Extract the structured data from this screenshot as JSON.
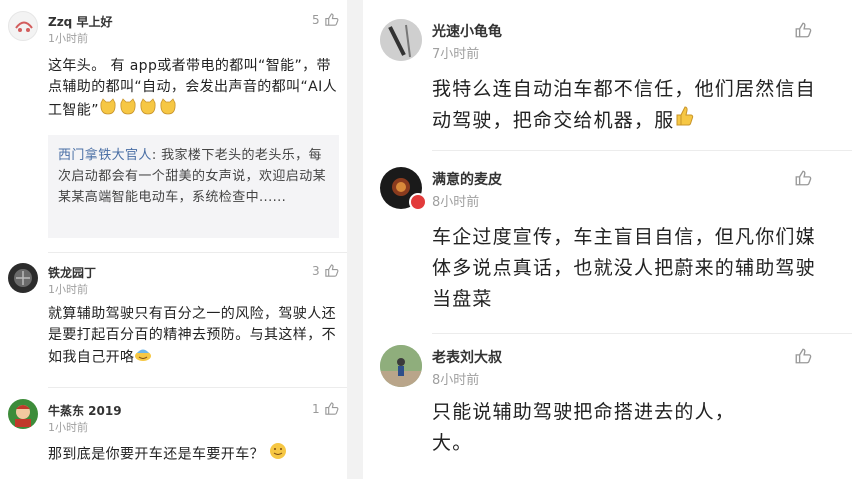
{
  "left_comments": [
    {
      "username": "Zzq 早上好",
      "time": "1小时前",
      "likes": "5",
      "text": "这年头。 有 app或者带电的都叫“智能”，带点辅助的都叫“自动，会发出声音的都叫“AI人工智能”",
      "emoji": "cat-face-icon x4",
      "reply": {
        "name": "西门拿铁大官人",
        "text": ": 我家楼下老头的老头乐，每次启动都会有一个甜美的女声说，欢迎启动某某某高端智能电动车，系统检查中......"
      }
    },
    {
      "username": "铁龙园丁",
      "time": "1小时前",
      "likes": "3",
      "text": "就算辅助驾驶只有百分之一的风险，驾驶人还是要打起百分百的精神去预防。与其这样，不如我自己开咯",
      "emoji": "sweat-smile-icon"
    },
    {
      "username": "牛蒸东 2019",
      "time": "1小时前",
      "likes": "1",
      "text": "那到底是你要开车还是车要开车？",
      "emoji": "smile-icon"
    }
  ],
  "right_comments": [
    {
      "username": "光速小龟龟",
      "time": "7小时前",
      "text": "我特么连自动泊车都不信任，他们居然信自动驾驶，把命交给机器，服",
      "emoji": "thumbs-up-icon"
    },
    {
      "username": "满意的麦皮",
      "time": "8小时前",
      "text": "车企过度宣传，车主盲目自信，但凡你们媒体多说点真话，也就没人把蔚来的辅助驾驶当盘菜"
    },
    {
      "username": "老表刘大叔",
      "time": "8小时前",
      "text": "只能说辅助驾驶把命搭进去的人，大。"
    }
  ],
  "colors": {
    "divider": "#f2f2f2",
    "link": "#4a6fa5",
    "muted": "#a0a0a0",
    "verify_badge": "#e23b3b"
  }
}
